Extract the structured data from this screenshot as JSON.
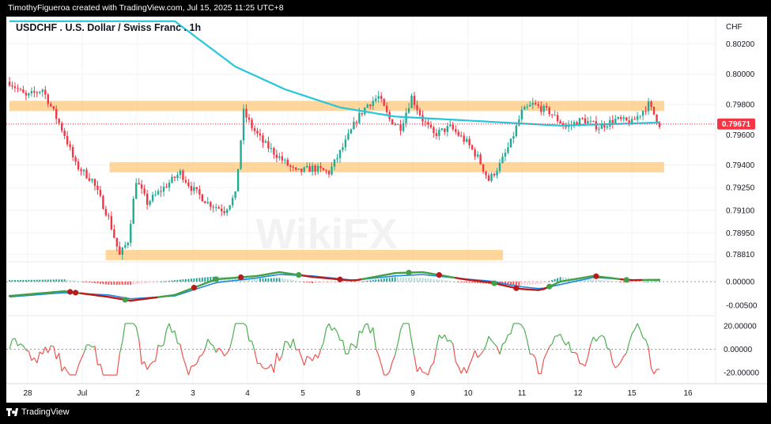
{
  "header": {
    "attribution": "TimothyFigueroa created with TradingView.com, Jul 15, 2025 11:25 UTC+8"
  },
  "footer": {
    "brand": "TradingView"
  },
  "watermark": "WikiFX",
  "colors": {
    "up": "#22ab94",
    "down": "#f23645",
    "ma": "#26c6da",
    "zone": "#ffb74d",
    "price_label": "#f23645",
    "macd_line": "#43a047",
    "signal_line": "#1e88e5",
    "osc_up": "#4caf50",
    "osc_down": "#ef5350"
  },
  "chart_data": [
    {
      "type": "candlestick",
      "title": "USDCHF . U.S. Dollar / Swiss Franc . 1h",
      "currency": "CHF",
      "last_price": "0.79671",
      "y_ticks": [
        "0.80200",
        "0.80000",
        "0.79800",
        "0.79600",
        "0.79400",
        "0.79250",
        "0.79100",
        "0.78950",
        "0.78810"
      ],
      "ylim": [
        0.7876,
        0.8026
      ],
      "x_ticks": [
        "28",
        "Jul",
        "2",
        "3",
        "4",
        "5",
        "8",
        "9",
        "10",
        "11",
        "12",
        "15",
        "16"
      ],
      "moving_average": "cyan line, ~200-period",
      "anchors": [
        [
          0,
          0.7995
        ],
        [
          6,
          0.7985
        ],
        [
          12,
          0.799
        ],
        [
          16,
          0.7975
        ],
        [
          20,
          0.796
        ],
        [
          24,
          0.794
        ],
        [
          30,
          0.793
        ],
        [
          36,
          0.7905
        ],
        [
          40,
          0.788
        ],
        [
          43,
          0.789
        ],
        [
          46,
          0.793
        ],
        [
          50,
          0.7915
        ],
        [
          56,
          0.7925
        ],
        [
          62,
          0.7935
        ],
        [
          66,
          0.7925
        ],
        [
          72,
          0.7915
        ],
        [
          78,
          0.791
        ],
        [
          82,
          0.792
        ],
        [
          85,
          0.7975
        ],
        [
          88,
          0.7965
        ],
        [
          92,
          0.7955
        ],
        [
          98,
          0.7945
        ],
        [
          104,
          0.7935
        ],
        [
          110,
          0.7938
        ],
        [
          116,
          0.7935
        ],
        [
          122,
          0.7955
        ],
        [
          126,
          0.797
        ],
        [
          130,
          0.798
        ],
        [
          134,
          0.7985
        ],
        [
          138,
          0.797
        ],
        [
          142,
          0.7965
        ],
        [
          146,
          0.7985
        ],
        [
          150,
          0.797
        ],
        [
          154,
          0.796
        ],
        [
          160,
          0.7965
        ],
        [
          166,
          0.7955
        ],
        [
          170,
          0.7945
        ],
        [
          174,
          0.793
        ],
        [
          178,
          0.794
        ],
        [
          182,
          0.7955
        ],
        [
          186,
          0.7975
        ],
        [
          190,
          0.798
        ],
        [
          196,
          0.7975
        ],
        [
          202,
          0.7965
        ],
        [
          208,
          0.797
        ],
        [
          214,
          0.7965
        ],
        [
          220,
          0.797
        ],
        [
          226,
          0.7968
        ],
        [
          232,
          0.798
        ],
        [
          236,
          0.7967
        ]
      ],
      "ma_anchors": [
        [
          0,
          0.8035
        ],
        [
          30,
          0.8035
        ],
        [
          60,
          0.8035
        ],
        [
          82,
          0.8005
        ],
        [
          100,
          0.799
        ],
        [
          120,
          0.7978
        ],
        [
          140,
          0.7972
        ],
        [
          160,
          0.797
        ],
        [
          180,
          0.7968
        ],
        [
          200,
          0.7966
        ],
        [
          236,
          0.7968
        ]
      ],
      "zones": [
        {
          "price": 0.7979,
          "from": 0,
          "to": 1
        },
        {
          "price": 0.79385,
          "from": 0.154,
          "to": 1
        },
        {
          "price": 0.78805,
          "from": 0.148,
          "to": 0.752
        }
      ]
    },
    {
      "type": "macd",
      "y_ticks": [
        "0.00000",
        "-0.00500"
      ],
      "ylim": [
        -0.0068,
        0.0035
      ],
      "line": [
        [
          0,
          -0.003
        ],
        [
          20,
          -0.002
        ],
        [
          36,
          -0.0032
        ],
        [
          44,
          -0.004
        ],
        [
          60,
          -0.0028
        ],
        [
          75,
          0.0005
        ],
        [
          90,
          0.0012
        ],
        [
          98,
          0.002
        ],
        [
          110,
          0.001
        ],
        [
          125,
          0.0002
        ],
        [
          140,
          0.0018
        ],
        [
          150,
          0.002
        ],
        [
          165,
          0.0005
        ],
        [
          175,
          -0.0002
        ],
        [
          185,
          -0.0015
        ],
        [
          193,
          -0.0018
        ],
        [
          200,
          0.0
        ],
        [
          212,
          0.0012
        ],
        [
          225,
          0.0003
        ],
        [
          236,
          0.0004
        ]
      ],
      "signal": [
        [
          0,
          -0.0032
        ],
        [
          20,
          -0.0023
        ],
        [
          36,
          -0.0028
        ],
        [
          44,
          -0.0036
        ],
        [
          60,
          -0.003
        ],
        [
          75,
          -0.0002
        ],
        [
          90,
          0.0008
        ],
        [
          98,
          0.0015
        ],
        [
          110,
          0.0012
        ],
        [
          125,
          0.0003
        ],
        [
          140,
          0.0012
        ],
        [
          150,
          0.0015
        ],
        [
          165,
          0.0006
        ],
        [
          175,
          0.0001
        ],
        [
          185,
          -0.001
        ],
        [
          193,
          -0.0015
        ],
        [
          200,
          -0.0006
        ],
        [
          212,
          0.0009
        ],
        [
          225,
          0.0004
        ],
        [
          236,
          0.0003
        ]
      ],
      "crosses": [
        [
          22,
          "down"
        ],
        [
          24,
          "down"
        ],
        [
          42,
          "up"
        ],
        [
          67,
          "down"
        ],
        [
          75,
          "up"
        ],
        [
          84,
          "down"
        ],
        [
          105,
          "up"
        ],
        [
          120,
          "down"
        ],
        [
          145,
          "up"
        ],
        [
          156,
          "down"
        ],
        [
          176,
          "up"
        ],
        [
          184,
          "down"
        ],
        [
          196,
          "up"
        ],
        [
          213,
          "down"
        ],
        [
          224,
          "up"
        ]
      ]
    },
    {
      "type": "oscillator",
      "y_ticks": [
        "20.00000",
        "0.00000",
        "-20.00000"
      ],
      "ylim": [
        -28,
        26
      ],
      "threshold": 0
    }
  ]
}
